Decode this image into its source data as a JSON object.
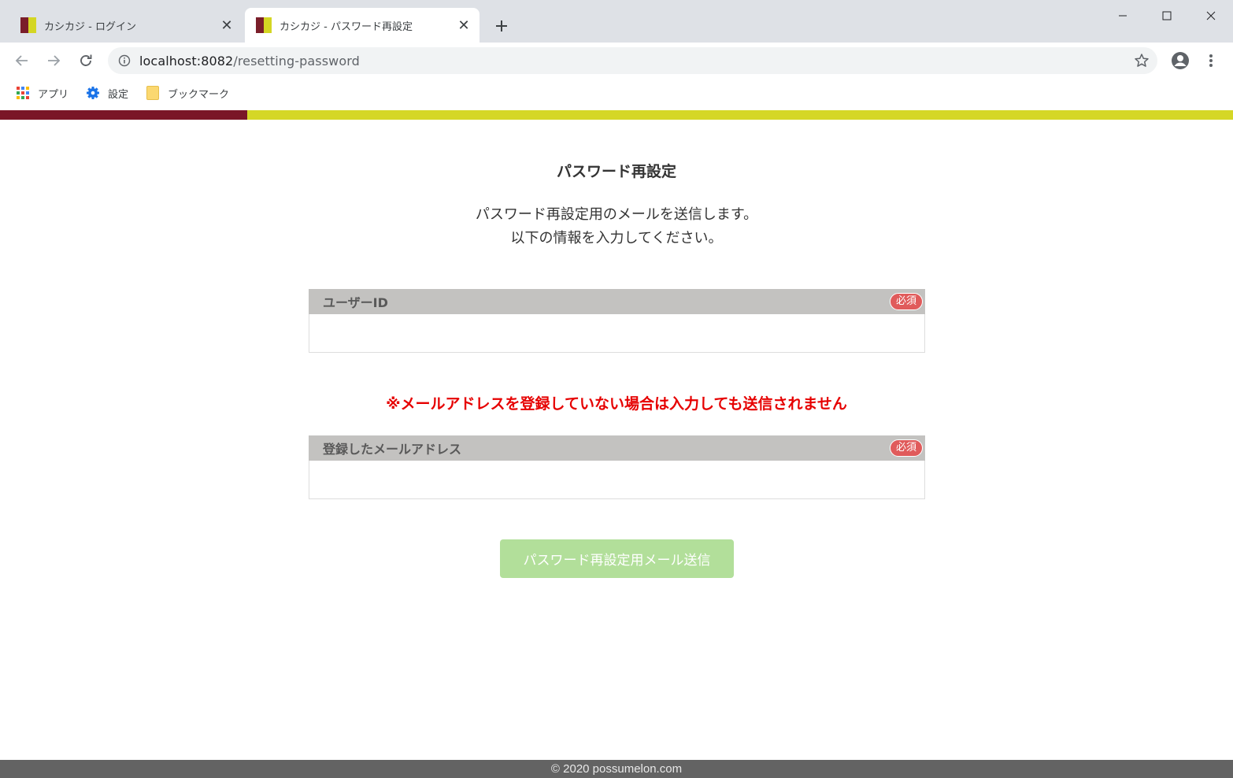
{
  "browser": {
    "tabs": [
      {
        "title": "カシカジ - ログイン",
        "active": false
      },
      {
        "title": "カシカジ - パスワード再設定",
        "active": true
      }
    ],
    "url": {
      "host": "localhost:8082",
      "path": "/resetting-password"
    },
    "bookmarks": [
      {
        "label": "アプリ",
        "icon": "apps-icon"
      },
      {
        "label": "設定",
        "icon": "gear-icon"
      },
      {
        "label": "ブックマーク",
        "icon": "folder-icon"
      }
    ]
  },
  "brand_colors": {
    "primary": "#7a1627",
    "secondary": "#d5d726"
  },
  "page": {
    "title": "パスワード再設定",
    "lead_line1": "パスワード再設定用のメールを送信します。",
    "lead_line2": "以下の情報を入力してください。",
    "fields": {
      "user_id": {
        "label": "ユーザーID",
        "badge": "必須",
        "value": ""
      },
      "email": {
        "label": "登録したメールアドレス",
        "badge": "必須",
        "value": ""
      }
    },
    "warning": "※メールアドレスを登録していない場合は入力しても送信されません",
    "submit_label": "パスワード再設定用メール送信",
    "footer": "© 2020 possumelon.com"
  }
}
